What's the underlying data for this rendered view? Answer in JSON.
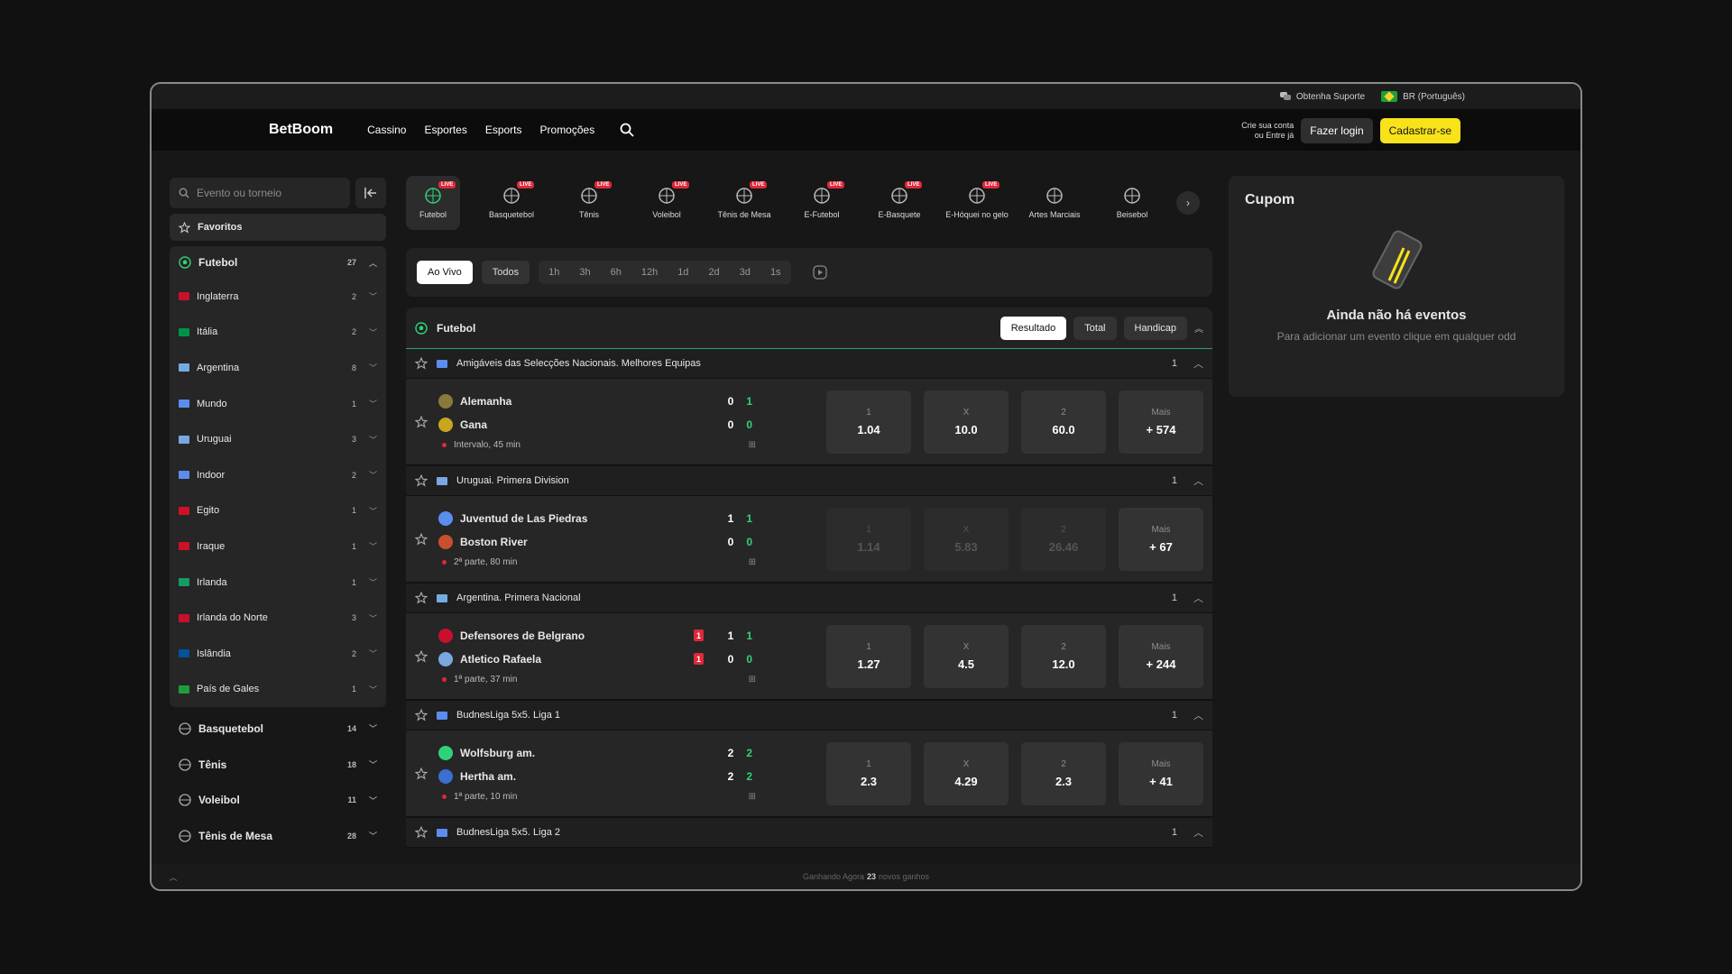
{
  "topbar": {
    "support": "Obtenha Suporte",
    "lang": "BR (Português)"
  },
  "nav": {
    "logo": "BetBoom",
    "links": [
      "Cassino",
      "Esportes",
      "Esports",
      "Promoções"
    ],
    "crie_line1": "Crie sua conta",
    "crie_line2": "ou Entre já",
    "login": "Fazer login",
    "register": "Cadastrar-se"
  },
  "sidebar": {
    "search_placeholder": "Evento ou torneio",
    "favorites": "Favoritos",
    "main_sport": {
      "label": "Futebol",
      "count": "27"
    },
    "countries": [
      {
        "label": "Inglaterra",
        "count": "2"
      },
      {
        "label": "Itália",
        "count": "2"
      },
      {
        "label": "Argentina",
        "count": "8"
      },
      {
        "label": "Mundo",
        "count": "1"
      },
      {
        "label": "Uruguai",
        "count": "3"
      },
      {
        "label": "Indoor",
        "count": "2"
      },
      {
        "label": "Egito",
        "count": "1"
      },
      {
        "label": "Iraque",
        "count": "1"
      },
      {
        "label": "Irlanda",
        "count": "1"
      },
      {
        "label": "Irlanda do Norte",
        "count": "3"
      },
      {
        "label": "Islândia",
        "count": "2"
      },
      {
        "label": "País de Gales",
        "count": "1"
      }
    ],
    "sports": [
      {
        "label": "Basquetebol",
        "count": "14"
      },
      {
        "label": "Tênis",
        "count": "18"
      },
      {
        "label": "Voleibol",
        "count": "11"
      },
      {
        "label": "Tênis de Mesa",
        "count": "28"
      }
    ]
  },
  "sports_tabs": [
    {
      "label": "Futebol",
      "live": "LIVE"
    },
    {
      "label": "Basquetebol",
      "live": "LIVE"
    },
    {
      "label": "Tênis",
      "live": "LIVE"
    },
    {
      "label": "Voleibol",
      "live": "LIVE"
    },
    {
      "label": "Tênis de Mesa",
      "live": "LIVE"
    },
    {
      "label": "E-Futebol",
      "live": "LIVE"
    },
    {
      "label": "E-Basquete",
      "live": "LIVE"
    },
    {
      "label": "E-Hóquei no gelo",
      "live": "LIVE"
    },
    {
      "label": "Artes Marciais",
      "live": ""
    },
    {
      "label": "Beisebol",
      "live": ""
    }
  ],
  "filters": {
    "live": "Ao Vivo",
    "all": "Todos",
    "times": [
      "1h",
      "3h",
      "6h",
      "12h",
      "1d",
      "2d",
      "3d",
      "1s"
    ]
  },
  "market": {
    "title": "Futebol",
    "tabs": [
      "Resultado",
      "Total",
      "Handicap"
    ]
  },
  "leagues": [
    {
      "name": "Amigáveis das Selecções Nacionais. Melhores Equipas",
      "count": "1",
      "match": {
        "home": "Alemanha",
        "away": "Gana",
        "home_score": "0",
        "home_set": "1",
        "away_score": "0",
        "away_set": "0",
        "status": "Intervalo, 45 min",
        "odds": [
          {
            "lab": "1",
            "val": "1.04"
          },
          {
            "lab": "X",
            "val": "10.0"
          },
          {
            "lab": "2",
            "val": "60.0"
          },
          {
            "lab": "Mais",
            "val": "+ 574"
          }
        ]
      }
    },
    {
      "name": "Uruguai. Primera Division",
      "count": "1",
      "match": {
        "home": "Juventud de Las Piedras",
        "away": "Boston River",
        "home_score": "1",
        "home_set": "1",
        "away_score": "0",
        "away_set": "0",
        "status": "2ª parte, 80 min",
        "odds": [
          {
            "lab": "1",
            "val": "1.14"
          },
          {
            "lab": "X",
            "val": "5.83"
          },
          {
            "lab": "2",
            "val": "26.46"
          },
          {
            "lab": "Mais",
            "val": "+ 67"
          }
        ]
      }
    },
    {
      "name": "Argentina. Primera Nacional",
      "count": "1",
      "match": {
        "home": "Defensores de Belgrano",
        "away": "Atletico Rafaela",
        "home_score": "1",
        "home_set": "1",
        "away_score": "0",
        "away_set": "0",
        "home_red": "1",
        "away_red": "1",
        "status": "1ª parte, 37 min",
        "odds": [
          {
            "lab": "1",
            "val": "1.27"
          },
          {
            "lab": "X",
            "val": "4.5"
          },
          {
            "lab": "2",
            "val": "12.0"
          },
          {
            "lab": "Mais",
            "val": "+ 244"
          }
        ]
      }
    },
    {
      "name": "BudnesLiga 5x5. Liga 1",
      "count": "1",
      "match": {
        "home": "Wolfsburg am.",
        "away": "Hertha am.",
        "home_score": "2",
        "home_set": "2",
        "away_score": "2",
        "away_set": "2",
        "status": "1ª parte, 10 min",
        "odds": [
          {
            "lab": "1",
            "val": "2.3"
          },
          {
            "lab": "X",
            "val": "4.29"
          },
          {
            "lab": "2",
            "val": "2.3"
          },
          {
            "lab": "Mais",
            "val": "+ 41"
          }
        ]
      }
    },
    {
      "name": "BudnesLiga 5x5. Liga 2",
      "count": "1"
    }
  ],
  "coupon": {
    "title": "Cupom",
    "empty": "Ainda não há eventos",
    "hint": "Para adicionar um evento clique em qualquer odd"
  },
  "footer": {
    "prefix": "Ganhando Agora",
    "count": "23",
    "suffix": "novos ganhos"
  }
}
